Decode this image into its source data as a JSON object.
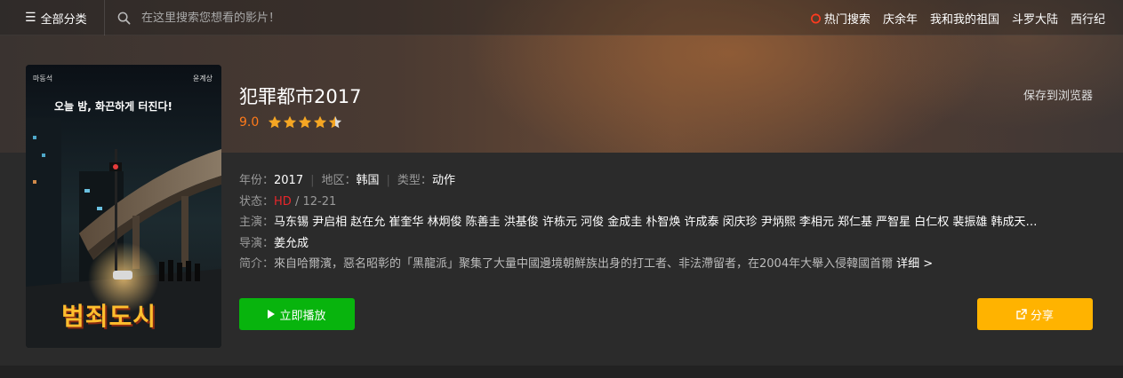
{
  "header": {
    "category_label": "全部分类",
    "search_placeholder": "在这里搜索您想看的影片！",
    "hot_label": "热门搜索",
    "hot_items": [
      "庆余年",
      "我和我的祖国",
      "斗罗大陆",
      "西行纪"
    ]
  },
  "movie": {
    "title": "犯罪都市2017",
    "score": "9.0",
    "stars": 4.5,
    "save_label": "保存到浏览器",
    "year_label": "年份：",
    "year": "2017",
    "region_label": "地区：",
    "region": "韩国",
    "type_label": "类型：",
    "type": "动作",
    "status_label": "状态：",
    "status_quality": "HD",
    "status_date": " / 12-21",
    "cast_label": "主演：",
    "cast": "马东锡 尹启相 赵在允 崔奎华 林炯俊 陈善圭 洪基俊 许栋元 河俊 金成圭 朴智焕 许成泰 闵庆珍 尹炳熙 李相元 郑仁基 严智星 白仁权 裴振雄 韩成天…",
    "director_label": "导演：",
    "director": "姜允成",
    "synopsis_label": "简介：",
    "synopsis": "來自哈爾濱，惡名昭彰的「黑龍派」聚集了大量中國邊境朝鮮族出身的打工者、非法滯留者，在2004年大舉入侵韓國首爾",
    "more_label": "详细 >"
  },
  "poster": {
    "top_left_name": "마동석",
    "top_right_name": "윤계상",
    "tagline": "오늘 밤, 화끈하게 터진다!",
    "title_art": "범죄도시"
  },
  "actions": {
    "play_label": "立即播放",
    "share_label": "分享"
  },
  "colors": {
    "play": "#08b40d",
    "share": "#ffb300",
    "score": "#ff7a1a",
    "hd": "#e8262a"
  }
}
